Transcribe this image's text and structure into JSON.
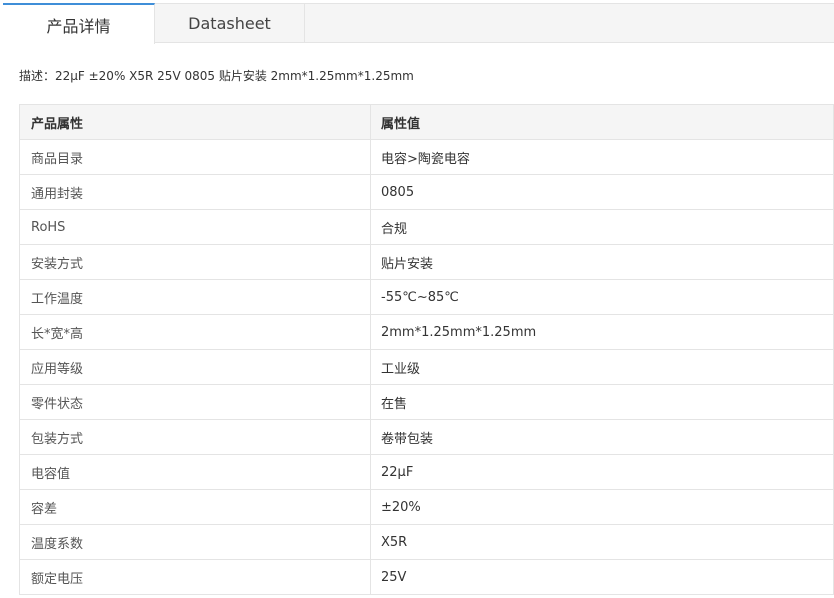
{
  "tabs": [
    {
      "label": "产品详情",
      "active": true
    },
    {
      "label": "Datasheet",
      "active": false
    }
  ],
  "description": "描述：22μF ±20% X5R 25V 0805 贴片安装 2mm*1.25mm*1.25mm",
  "table": {
    "headers": {
      "name": "产品属性",
      "value": "属性值"
    },
    "rows": [
      {
        "name": "商品目录",
        "value": "电容>陶瓷电容"
      },
      {
        "name": "通用封装",
        "value": "0805"
      },
      {
        "name": "RoHS",
        "value": "合规"
      },
      {
        "name": "安装方式",
        "value": "贴片安装"
      },
      {
        "name": "工作温度",
        "value": "-55℃~85℃"
      },
      {
        "name": "长*宽*高",
        "value": "2mm*1.25mm*1.25mm"
      },
      {
        "name": "应用等级",
        "value": "工业级"
      },
      {
        "name": "零件状态",
        "value": "在售"
      },
      {
        "name": "包装方式",
        "value": "卷带包装"
      },
      {
        "name": "电容值",
        "value": "22μF"
      },
      {
        "name": "容差",
        "value": "±20%"
      },
      {
        "name": "温度系数",
        "value": "X5R"
      },
      {
        "name": "额定电压",
        "value": "25V"
      }
    ]
  },
  "colors": {
    "active_tab_accent": "#3f8ed8",
    "border": "#e4e4e4",
    "header_bg": "#f5f5f5"
  }
}
